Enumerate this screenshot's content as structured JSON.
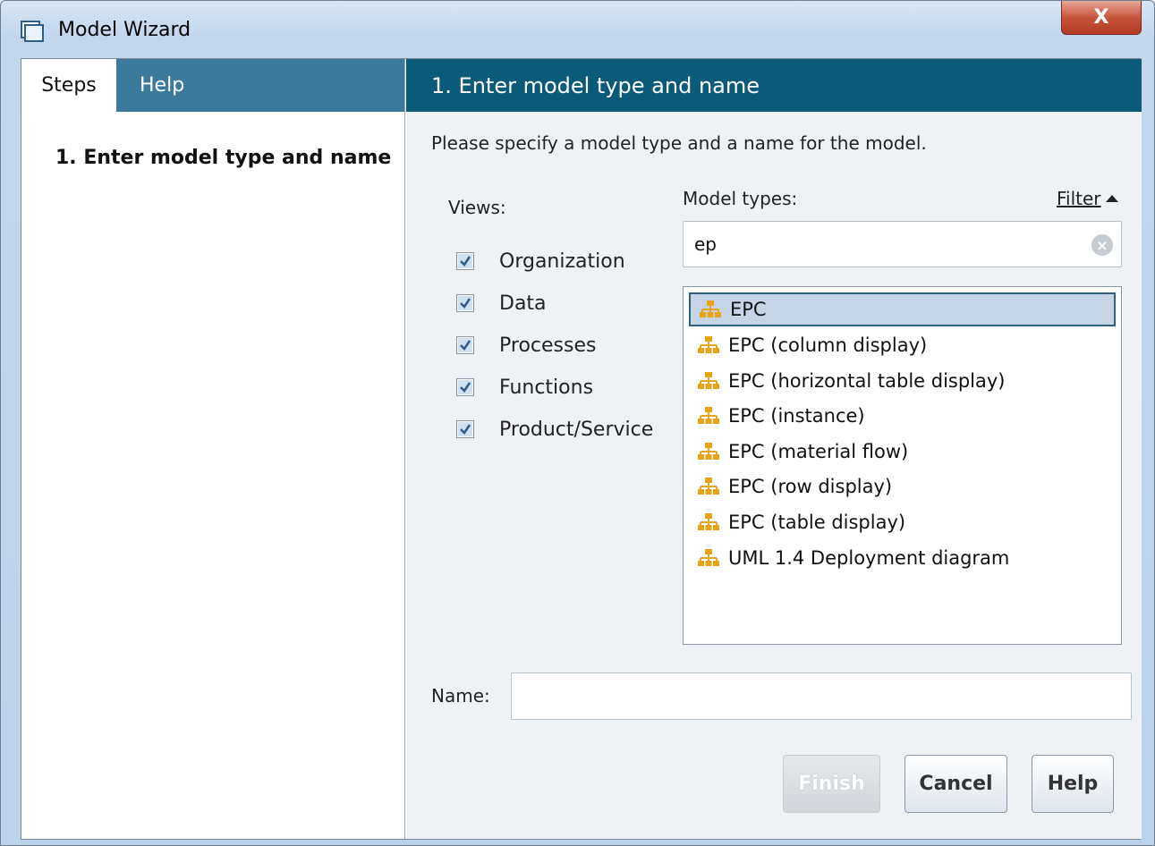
{
  "window": {
    "title": "Model Wizard",
    "close_label": "X"
  },
  "left": {
    "tabs": [
      {
        "label": "Steps",
        "active": true
      },
      {
        "label": "Help",
        "active": false
      }
    ],
    "steps": [
      "1. Enter model type and name"
    ]
  },
  "right": {
    "header": "1. Enter model type and name",
    "instructions": "Please specify a model type and a name for the model.",
    "views_label": "Views:",
    "views": [
      {
        "label": "Organization",
        "checked": true
      },
      {
        "label": "Data",
        "checked": true
      },
      {
        "label": "Processes",
        "checked": true
      },
      {
        "label": "Functions",
        "checked": true
      },
      {
        "label": "Product/Service",
        "checked": true
      }
    ],
    "model_types_label": "Model types:",
    "filter_label": "Filter",
    "filter_value": "ep",
    "model_types": [
      {
        "label": "EPC",
        "selected": true
      },
      {
        "label": "EPC (column display)",
        "selected": false
      },
      {
        "label": "EPC (horizontal table display)",
        "selected": false
      },
      {
        "label": "EPC (instance)",
        "selected": false
      },
      {
        "label": "EPC (material flow)",
        "selected": false
      },
      {
        "label": "EPC (row display)",
        "selected": false
      },
      {
        "label": "EPC (table display)",
        "selected": false
      },
      {
        "label": "UML 1.4 Deployment diagram",
        "selected": false
      }
    ],
    "name_label": "Name:",
    "name_value": ""
  },
  "buttons": {
    "finish": "Finish",
    "cancel": "Cancel",
    "help": "Help"
  },
  "colors": {
    "header_bg": "#0c5a7a",
    "tab_bar_bg": "#3c7a9d",
    "selection_bg": "#c5d5e6",
    "icon_orange": "#e8a317"
  }
}
